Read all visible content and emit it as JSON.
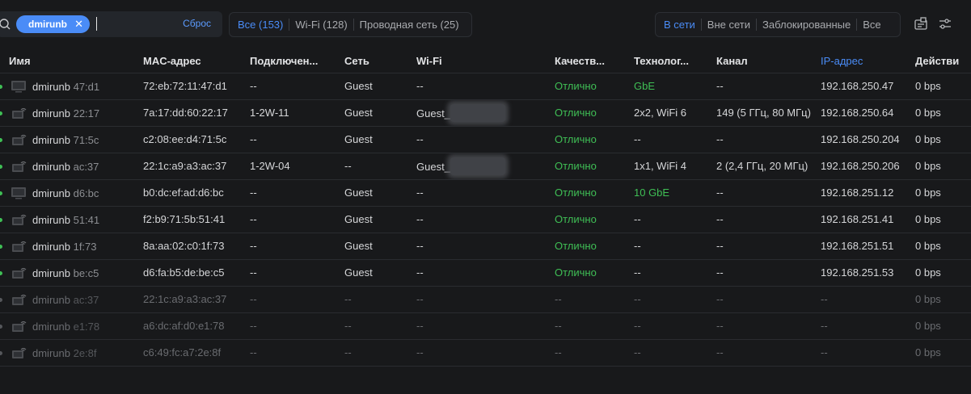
{
  "search": {
    "chip_label": "dmirunb",
    "reset_label": "Сброс"
  },
  "filters": {
    "connection": [
      "Все (153)",
      "Wi-Fi (128)",
      "Проводная сеть (25)"
    ],
    "status": [
      "В сети",
      "Вне сети",
      "Заблокированные",
      "Все"
    ]
  },
  "columns": [
    "Имя",
    "MAC-адрес",
    "Подключен...",
    "Сеть",
    "Wi-Fi",
    "Качеств...",
    "Технолог...",
    "Канал",
    "IP-адрес",
    "Действи"
  ],
  "rows": [
    {
      "name": "dmirunb",
      "suffix": "47:d1",
      "mac": "72:eb:72:11:47:d1",
      "conn": "--",
      "network": "Guest",
      "wifi": "--",
      "quality": "Отлично",
      "tech": "GbE",
      "channel": "--",
      "ip": "192.168.250.47",
      "act": "0 bps",
      "icon": "monitor-icon"
    },
    {
      "name": "dmirunb",
      "suffix": "22:17",
      "mac": "7a:17:dd:60:22:17",
      "conn": "1-2W-11",
      "network": "Guest",
      "wifi": "Guest_",
      "quality": "Отлично",
      "tech": "2x2, WiFi 6",
      "channel": "149 (5 ГГц, 80 МГц)",
      "ip": "192.168.250.64",
      "act": "0 bps",
      "icon": "wifi-device-icon"
    },
    {
      "name": "dmirunb",
      "suffix": "71:5c",
      "mac": "c2:08:ee:d4:71:5c",
      "conn": "--",
      "network": "Guest",
      "wifi": "--",
      "quality": "Отлично",
      "tech": "--",
      "channel": "--",
      "ip": "192.168.250.204",
      "act": "0 bps",
      "icon": "wifi-device-icon"
    },
    {
      "name": "dmirunb",
      "suffix": "ac:37",
      "mac": "22:1c:a9:a3:ac:37",
      "conn": "1-2W-04",
      "network": "--",
      "wifi": "Guest_",
      "quality": "Отлично",
      "tech": "1x1, WiFi 4",
      "channel": "2 (2,4 ГГц, 20 МГц)",
      "ip": "192.168.250.206",
      "act": "0 bps",
      "icon": "wifi-device-icon"
    },
    {
      "name": "dmirunb",
      "suffix": "d6:bc",
      "mac": "b0:dc:ef:ad:d6:bc",
      "conn": "--",
      "network": "Guest",
      "wifi": "--",
      "quality": "Отлично",
      "tech": "10 GbE",
      "channel": "--",
      "ip": "192.168.251.12",
      "act": "0 bps",
      "icon": "monitor-icon"
    },
    {
      "name": "dmirunb",
      "suffix": "51:41",
      "mac": "f2:b9:71:5b:51:41",
      "conn": "--",
      "network": "Guest",
      "wifi": "--",
      "quality": "Отлично",
      "tech": "--",
      "channel": "--",
      "ip": "192.168.251.41",
      "act": "0 bps",
      "icon": "wifi-device-icon"
    },
    {
      "name": "dmirunb",
      "suffix": "1f:73",
      "mac": "8a:aa:02:c0:1f:73",
      "conn": "--",
      "network": "Guest",
      "wifi": "--",
      "quality": "Отлично",
      "tech": "--",
      "channel": "--",
      "ip": "192.168.251.51",
      "act": "0 bps",
      "icon": "wifi-device-icon"
    },
    {
      "name": "dmirunb",
      "suffix": "be:c5",
      "mac": "d6:fa:b5:de:be:c5",
      "conn": "--",
      "network": "Guest",
      "wifi": "--",
      "quality": "Отлично",
      "tech": "--",
      "channel": "--",
      "ip": "192.168.251.53",
      "act": "0 bps",
      "icon": "wifi-device-icon"
    },
    {
      "name": "dmirunb",
      "suffix": "ac:37",
      "mac": "22:1c:a9:a3:ac:37",
      "conn": "--",
      "network": "--",
      "wifi": "--",
      "quality": "--",
      "tech": "--",
      "channel": "--",
      "ip": "--",
      "act": "0 bps",
      "icon": "wifi-device-icon",
      "offline": true
    },
    {
      "name": "dmirunb",
      "suffix": "e1:78",
      "mac": "a6:dc:af:d0:e1:78",
      "conn": "--",
      "network": "--",
      "wifi": "--",
      "quality": "--",
      "tech": "--",
      "channel": "--",
      "ip": "--",
      "act": "0 bps",
      "icon": "wifi-device-icon",
      "offline": true
    },
    {
      "name": "dmirunb",
      "suffix": "2e:8f",
      "mac": "c6:49:fc:a7:2e:8f",
      "conn": "--",
      "network": "--",
      "wifi": "--",
      "quality": "--",
      "tech": "--",
      "channel": "--",
      "ip": "--",
      "act": "0 bps",
      "icon": "wifi-device-icon",
      "offline": true
    }
  ],
  "colors": {
    "accent": "#4a8cf7",
    "good": "#3fbf55",
    "background": "#18191b"
  }
}
